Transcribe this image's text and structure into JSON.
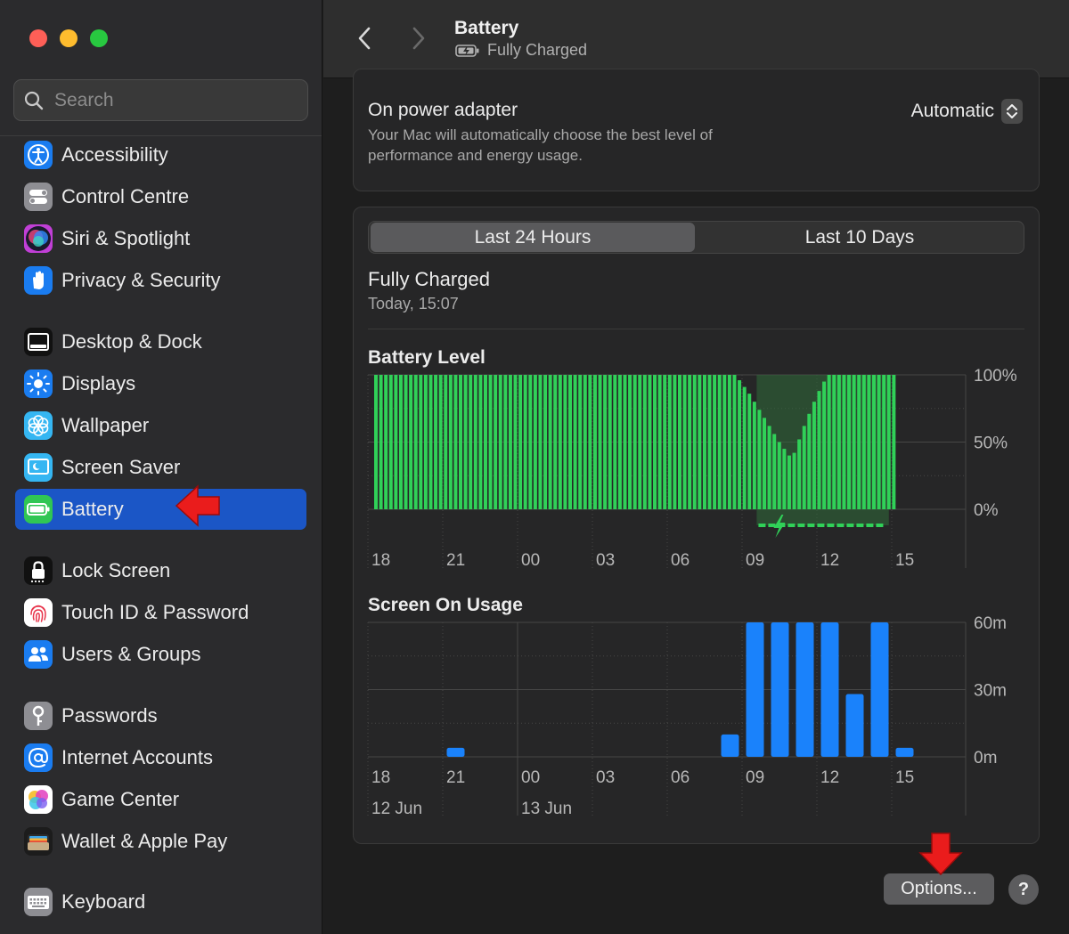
{
  "window": {
    "traffic_lights": {
      "close": "#fe5f57",
      "minimize": "#febc2e",
      "zoom": "#28c840"
    }
  },
  "sidebar": {
    "search": {
      "placeholder": "Search"
    },
    "items": [
      {
        "label": "Accessibility",
        "icon": "accessibility-icon",
        "color": "#1a7cf0",
        "selected": false
      },
      {
        "label": "Control Centre",
        "icon": "control-centre-icon",
        "color": "#8e8e93",
        "selected": false
      },
      {
        "label": "Siri & Spotlight",
        "icon": "siri-icon",
        "color": "#c13fd6",
        "selected": false
      },
      {
        "label": "Privacy & Security",
        "icon": "hand-icon",
        "color": "#1a7cf0",
        "selected": false
      },
      {
        "label": "Desktop & Dock",
        "icon": "dock-icon",
        "color": "#111111",
        "selected": false
      },
      {
        "label": "Displays",
        "icon": "sun-icon",
        "color": "#1a7cf0",
        "selected": false
      },
      {
        "label": "Wallpaper",
        "icon": "flower-icon",
        "color": "#35b6f2",
        "selected": false
      },
      {
        "label": "Screen Saver",
        "icon": "screen-saver-icon",
        "color": "#35b6f2",
        "selected": false
      },
      {
        "label": "Battery",
        "icon": "battery-icon",
        "color": "#30c654",
        "selected": true
      },
      {
        "label": "Lock Screen",
        "icon": "lock-icon",
        "color": "#111111",
        "selected": false
      },
      {
        "label": "Touch ID & Password",
        "icon": "fingerprint-icon",
        "color": "#ffffff",
        "selected": false
      },
      {
        "label": "Users & Groups",
        "icon": "users-icon",
        "color": "#1a7cf0",
        "selected": false
      },
      {
        "label": "Passwords",
        "icon": "key-icon",
        "color": "#8e8e93",
        "selected": false
      },
      {
        "label": "Internet Accounts",
        "icon": "at-icon",
        "color": "#1a7cf0",
        "selected": false
      },
      {
        "label": "Game Center",
        "icon": "game-center-icon",
        "color": "#ffffff",
        "selected": false
      },
      {
        "label": "Wallet & Apple Pay",
        "icon": "wallet-icon",
        "color": "#1c1c1c",
        "selected": false
      },
      {
        "label": "Keyboard",
        "icon": "keyboard-icon",
        "color": "#8e8e93",
        "selected": false
      }
    ]
  },
  "header": {
    "title": "Battery",
    "subtitle": "Fully Charged"
  },
  "power": {
    "label": "On power adapter",
    "description": "Your Mac will automatically choose the best level of performance and energy usage.",
    "value": "Automatic"
  },
  "usage": {
    "tabs": [
      {
        "label": "Last 24 Hours",
        "selected": true
      },
      {
        "label": "Last 10 Days",
        "selected": false
      }
    ],
    "status_title": "Fully Charged",
    "status_time": "Today, 15:07"
  },
  "buttons": {
    "options": "Options...",
    "help": "?"
  },
  "colors": {
    "battery_bar": "#30d158",
    "usage_bar": "#1a82fb",
    "accent": "#1b56c6",
    "annotation": "#ea1c1c"
  },
  "chart_data": [
    {
      "type": "bar",
      "title": "Battery Level",
      "yunit": "%",
      "ylim": [
        0,
        100
      ],
      "yticks": [
        "100%",
        "50%",
        "0%"
      ],
      "x_tick_labels": [
        "18",
        "21",
        "00",
        "03",
        "06",
        "09",
        "12",
        "15"
      ],
      "values": [
        100,
        100,
        100,
        100,
        100,
        100,
        100,
        100,
        100,
        100,
        100,
        100,
        100,
        100,
        100,
        100,
        100,
        100,
        100,
        100,
        100,
        100,
        100,
        100,
        100,
        100,
        100,
        100,
        100,
        100,
        100,
        100,
        100,
        100,
        100,
        100,
        100,
        100,
        100,
        100,
        100,
        100,
        100,
        100,
        100,
        100,
        100,
        100,
        100,
        100,
        100,
        100,
        100,
        100,
        100,
        100,
        100,
        100,
        100,
        100,
        100,
        100,
        100,
        100,
        100,
        100,
        100,
        100,
        100,
        100,
        100,
        100,
        100,
        96,
        91,
        86,
        80,
        74,
        68,
        62,
        56,
        50,
        45,
        40,
        42,
        52,
        62,
        71,
        80,
        88,
        95,
        100,
        100,
        100,
        100,
        100,
        100,
        100,
        100,
        100,
        100,
        100,
        100,
        100,
        100
      ],
      "charging_start_index": 77,
      "charging_end_index": 102
    },
    {
      "type": "bar",
      "title": "Screen On Usage",
      "yunit": "minutes",
      "ylim": [
        0,
        60
      ],
      "yticks": [
        "60m",
        "30m",
        "0m"
      ],
      "x_tick_labels": [
        "18",
        "21",
        "00",
        "03",
        "06",
        "09",
        "12",
        "15"
      ],
      "date_labels": [
        "12 Jun",
        "13 Jun"
      ],
      "values": [
        0,
        0,
        0,
        4,
        0,
        0,
        0,
        0,
        0,
        0,
        0,
        0,
        0,
        0,
        10,
        60,
        60,
        60,
        60,
        28,
        60,
        4
      ]
    }
  ]
}
